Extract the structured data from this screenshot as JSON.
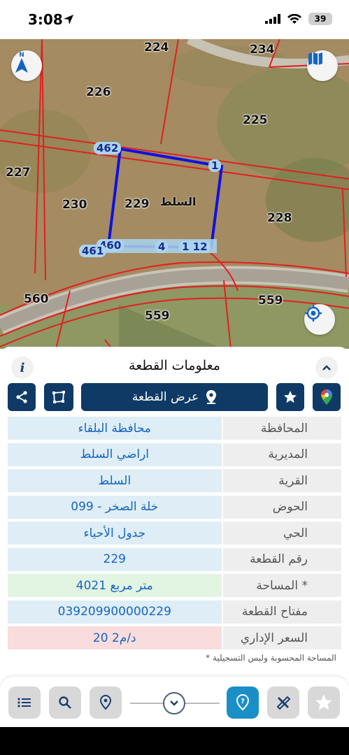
{
  "status": {
    "time": "3:08",
    "battery": "39"
  },
  "map": {
    "parcel_numbers": [
      "224",
      "234",
      "226",
      "225",
      "227",
      "230",
      "229",
      "228",
      "560",
      "559",
      "559"
    ],
    "plot_name": "السلط",
    "vertex_labels": [
      "462",
      "1",
      "460",
      "461",
      "4",
      "1 12"
    ]
  },
  "panel": {
    "title": "معلومات القطعة",
    "show_plot_label": "عرض القطعة",
    "rows": [
      {
        "label": "المحافظة",
        "value": "محافظة البلقاء"
      },
      {
        "label": "المديرية",
        "value": "اراضي السلط"
      },
      {
        "label": "القرية",
        "value": "السلط"
      },
      {
        "label": "الحوض",
        "value": "خلة الصخر - 099"
      },
      {
        "label": "الحي",
        "value": "جدول الأحياء"
      },
      {
        "label": "رقم القطعة",
        "value": "229"
      },
      {
        "label": "المساحة *",
        "value": "4021  متر مربع"
      },
      {
        "label": "مفتاح القطعة",
        "value": "039209900000229"
      },
      {
        "label": "السعر الإداري",
        "value": "20 د/م2"
      }
    ],
    "footnote": "* المساحة المحسوبة وليس التسجيلية"
  },
  "colors": {
    "primary": "#0f3a66",
    "accent": "#1a8fc7",
    "plot_outline": "#1010e0",
    "boundary": "#e02020"
  }
}
